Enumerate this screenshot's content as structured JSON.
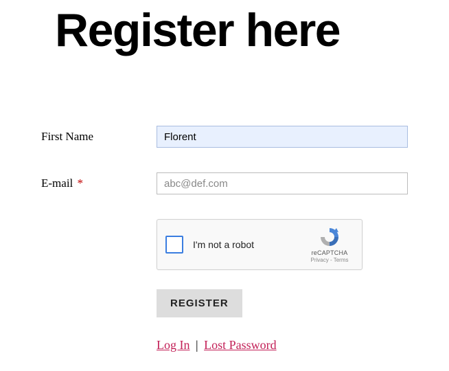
{
  "page": {
    "title": "Register here"
  },
  "form": {
    "first_name": {
      "label": "First Name",
      "value": "Florent"
    },
    "email": {
      "label": "E-mail",
      "required_marker": "*",
      "placeholder": "abc@def.com"
    },
    "captcha": {
      "label": "I'm not a robot",
      "brand": "reCAPTCHA",
      "terms": "Privacy - Terms"
    },
    "submit_label": "REGISTER"
  },
  "links": {
    "login": "Log In",
    "separator": "|",
    "lost_password": "Lost Password"
  }
}
